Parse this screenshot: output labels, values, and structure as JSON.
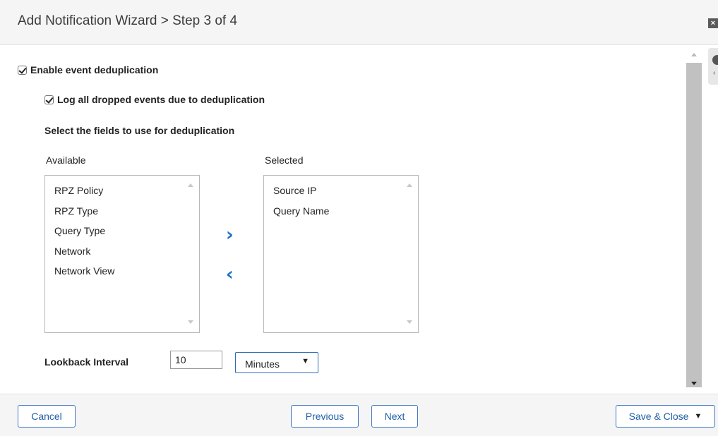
{
  "header": {
    "title": "Add Notification Wizard > Step 3 of 4",
    "close_label": "x"
  },
  "dedup": {
    "enable_label": "Enable event deduplication",
    "enable_checked": true,
    "log_label": "Log all dropped events due to deduplication",
    "log_checked": true,
    "fields_title": "Select the fields to use for deduplication"
  },
  "available": {
    "heading": "Available",
    "items": [
      "RPZ Policy",
      "RPZ Type",
      "Query Type",
      "Network",
      "Network View"
    ]
  },
  "selected": {
    "heading": "Selected",
    "items": [
      "Source IP",
      "Query Name"
    ]
  },
  "transfer": {
    "add_icon": "chevron-right-icon",
    "remove_icon": "chevron-left-icon"
  },
  "lookback": {
    "label": "Lookback Interval",
    "value": "10",
    "unit": "Minutes"
  },
  "footer": {
    "cancel": "Cancel",
    "previous": "Previous",
    "next": "Next",
    "save_close": "Save & Close"
  },
  "colors": {
    "accent": "#1a6fc9",
    "button_text": "#1f5ea8",
    "bar_bg": "#f6f5f6"
  }
}
